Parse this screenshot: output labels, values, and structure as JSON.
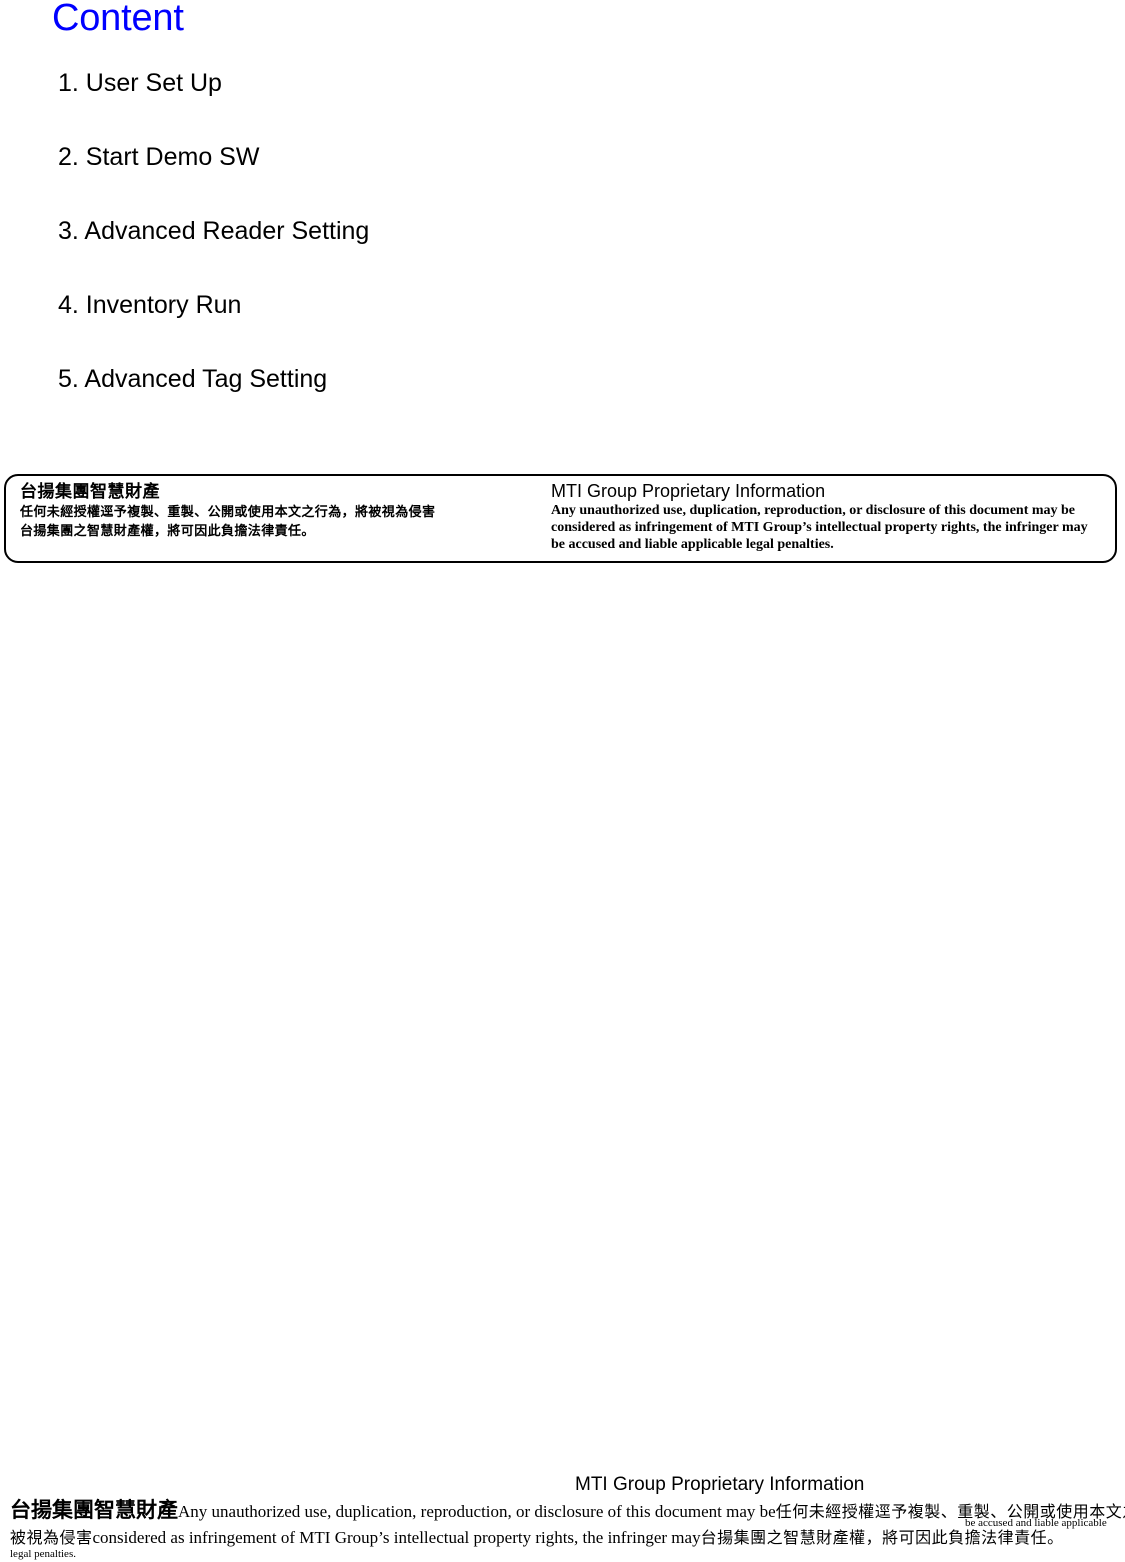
{
  "slide": {
    "title": "Content",
    "title_color": "#0000ff",
    "agenda": [
      "1. User Set Up",
      "2. Start Demo SW",
      "3. Advanced Reader Setting",
      "4. Inventory Run",
      "5. Advanced Tag Setting"
    ]
  },
  "notice_box": {
    "zh_heading": "台揚集團智慧財產",
    "zh_line1": "任何未經授權逕予複製、重製、公開或使用本文之行為，將被視為侵害",
    "zh_line2": "台揚集團之智慧財產權，將可因此負擔法律責任。",
    "en_heading": "MTI Group Proprietary Information",
    "en_line1": "Any unauthorized use, duplication, reproduction, or disclosure of this document may be",
    "en_line2": "considered as infringement of MTI Group’s intellectual property rights, the infringer may",
    "en_line3": "be accused and liable applicable legal penalties."
  },
  "footer": {
    "en_heading": "MTI Group Proprietary Information",
    "line1_zh": "台揚集團智慧財產",
    "line1_en": "Any unauthorized use, duplication, reproduction, or disclosure of this document may be",
    "line1_zh_tail": "任何未經授權逕予複製、重製、公開或使用本文之行為，將",
    "line2_zh": "被視為侵害",
    "line2_en": "considered as infringement of MTI Group’s intellectual property rights, the infringer may",
    "line2_zh_tail": "台揚集團之智慧財產權，將可因此負擔法律責任。",
    "line3_en": "legal penalties.",
    "small_right": "be accused and liable applicable"
  }
}
